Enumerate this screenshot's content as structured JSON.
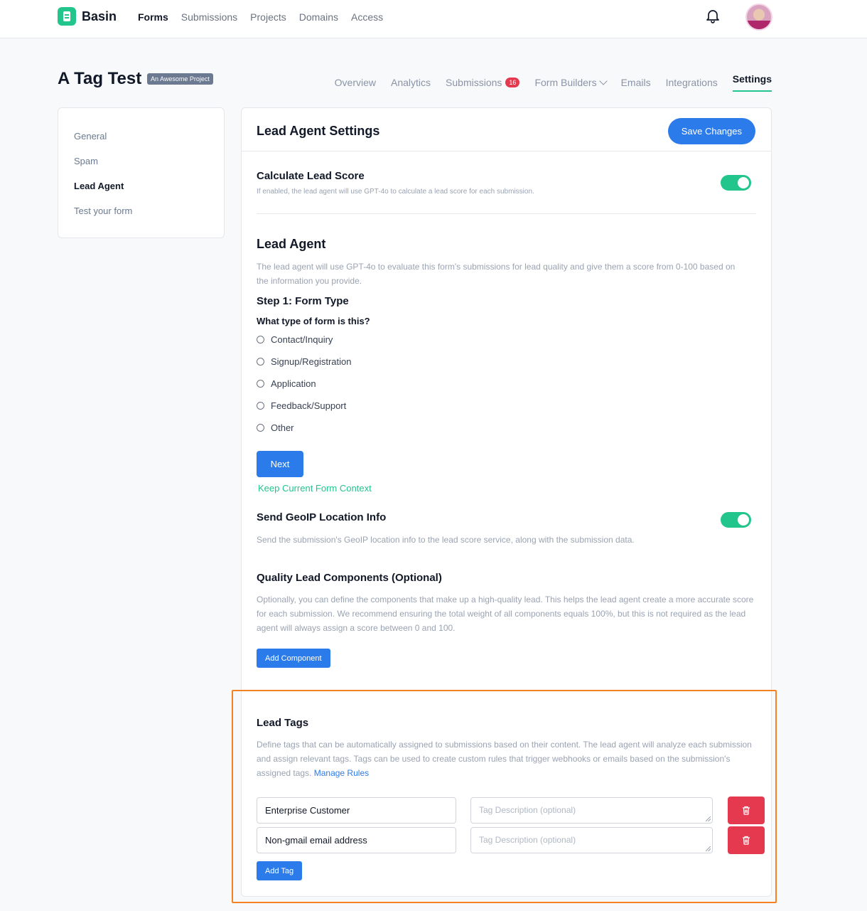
{
  "topbar": {
    "brand": "Basin",
    "nav": [
      "Forms",
      "Submissions",
      "Projects",
      "Domains",
      "Access"
    ],
    "active_nav": "Forms",
    "notification_icon": "bell-icon",
    "avatar_icon": "user-avatar"
  },
  "project": {
    "title": "A Tag Test",
    "badge": "An Awesome Project",
    "tabs": {
      "overview": "Overview",
      "analytics": "Analytics",
      "submissions": "Submissions",
      "submissions_count": "16",
      "form_builders": "Form Builders",
      "emails": "Emails",
      "integrations": "Integrations",
      "settings": "Settings"
    }
  },
  "sidebar": {
    "items": [
      "General",
      "Spam",
      "Lead Agent",
      "Test your form"
    ],
    "active": "Lead Agent"
  },
  "card": {
    "title": "Lead Agent Settings",
    "save_label": "Save Changes"
  },
  "calc_score": {
    "title": "Calculate Lead Score",
    "description": "If enabled, the lead agent will use GPT-4o to calculate a lead score for each submission.",
    "enabled": true
  },
  "lead_agent": {
    "title": "Lead Agent",
    "description": "The lead agent will use GPT-4o to evaluate this form's submissions for lead quality and give them a score from 0-100 based on the information you provide.",
    "step_title": "Step 1: Form Type",
    "question": "What type of form is this?",
    "options": [
      "Contact/Inquiry",
      "Signup/Registration",
      "Application",
      "Feedback/Support",
      "Other"
    ],
    "next_label": "Next",
    "keep_context_label": "Keep Current Form Context"
  },
  "geoip": {
    "title": "Send GeoIP Location Info",
    "description": "Send the submission's GeoIP location info to the lead score service, along with the submission data.",
    "enabled": true
  },
  "components": {
    "title": "Quality Lead Components (Optional)",
    "description": "Optionally, you can define the components that make up a high-quality lead. This helps the lead agent create a more accurate score for each submission. We recommend ensuring the total weight of all components equals 100%, but this is not required as the lead agent will always assign a score between 0 and 100.",
    "add_label": "Add Component"
  },
  "tags": {
    "title": "Lead Tags",
    "description": "Define tags that can be automatically assigned to submissions based on their content. The lead agent will analyze each submission and assign relevant tags. Tags can be used to create custom rules that trigger webhooks or emails based on the submission's assigned tags.",
    "manage_rules_label": "Manage Rules",
    "rows": [
      {
        "name": "Enterprise Customer",
        "description_placeholder": "Tag Description (optional)"
      },
      {
        "name": "Non-gmail email address",
        "description_placeholder": "Tag Description (optional)"
      }
    ],
    "add_label": "Add Tag"
  },
  "colors": {
    "accent": "#2b7bea",
    "brand_green": "#22c58b",
    "danger": "#e53950",
    "highlight": "#f58220"
  }
}
